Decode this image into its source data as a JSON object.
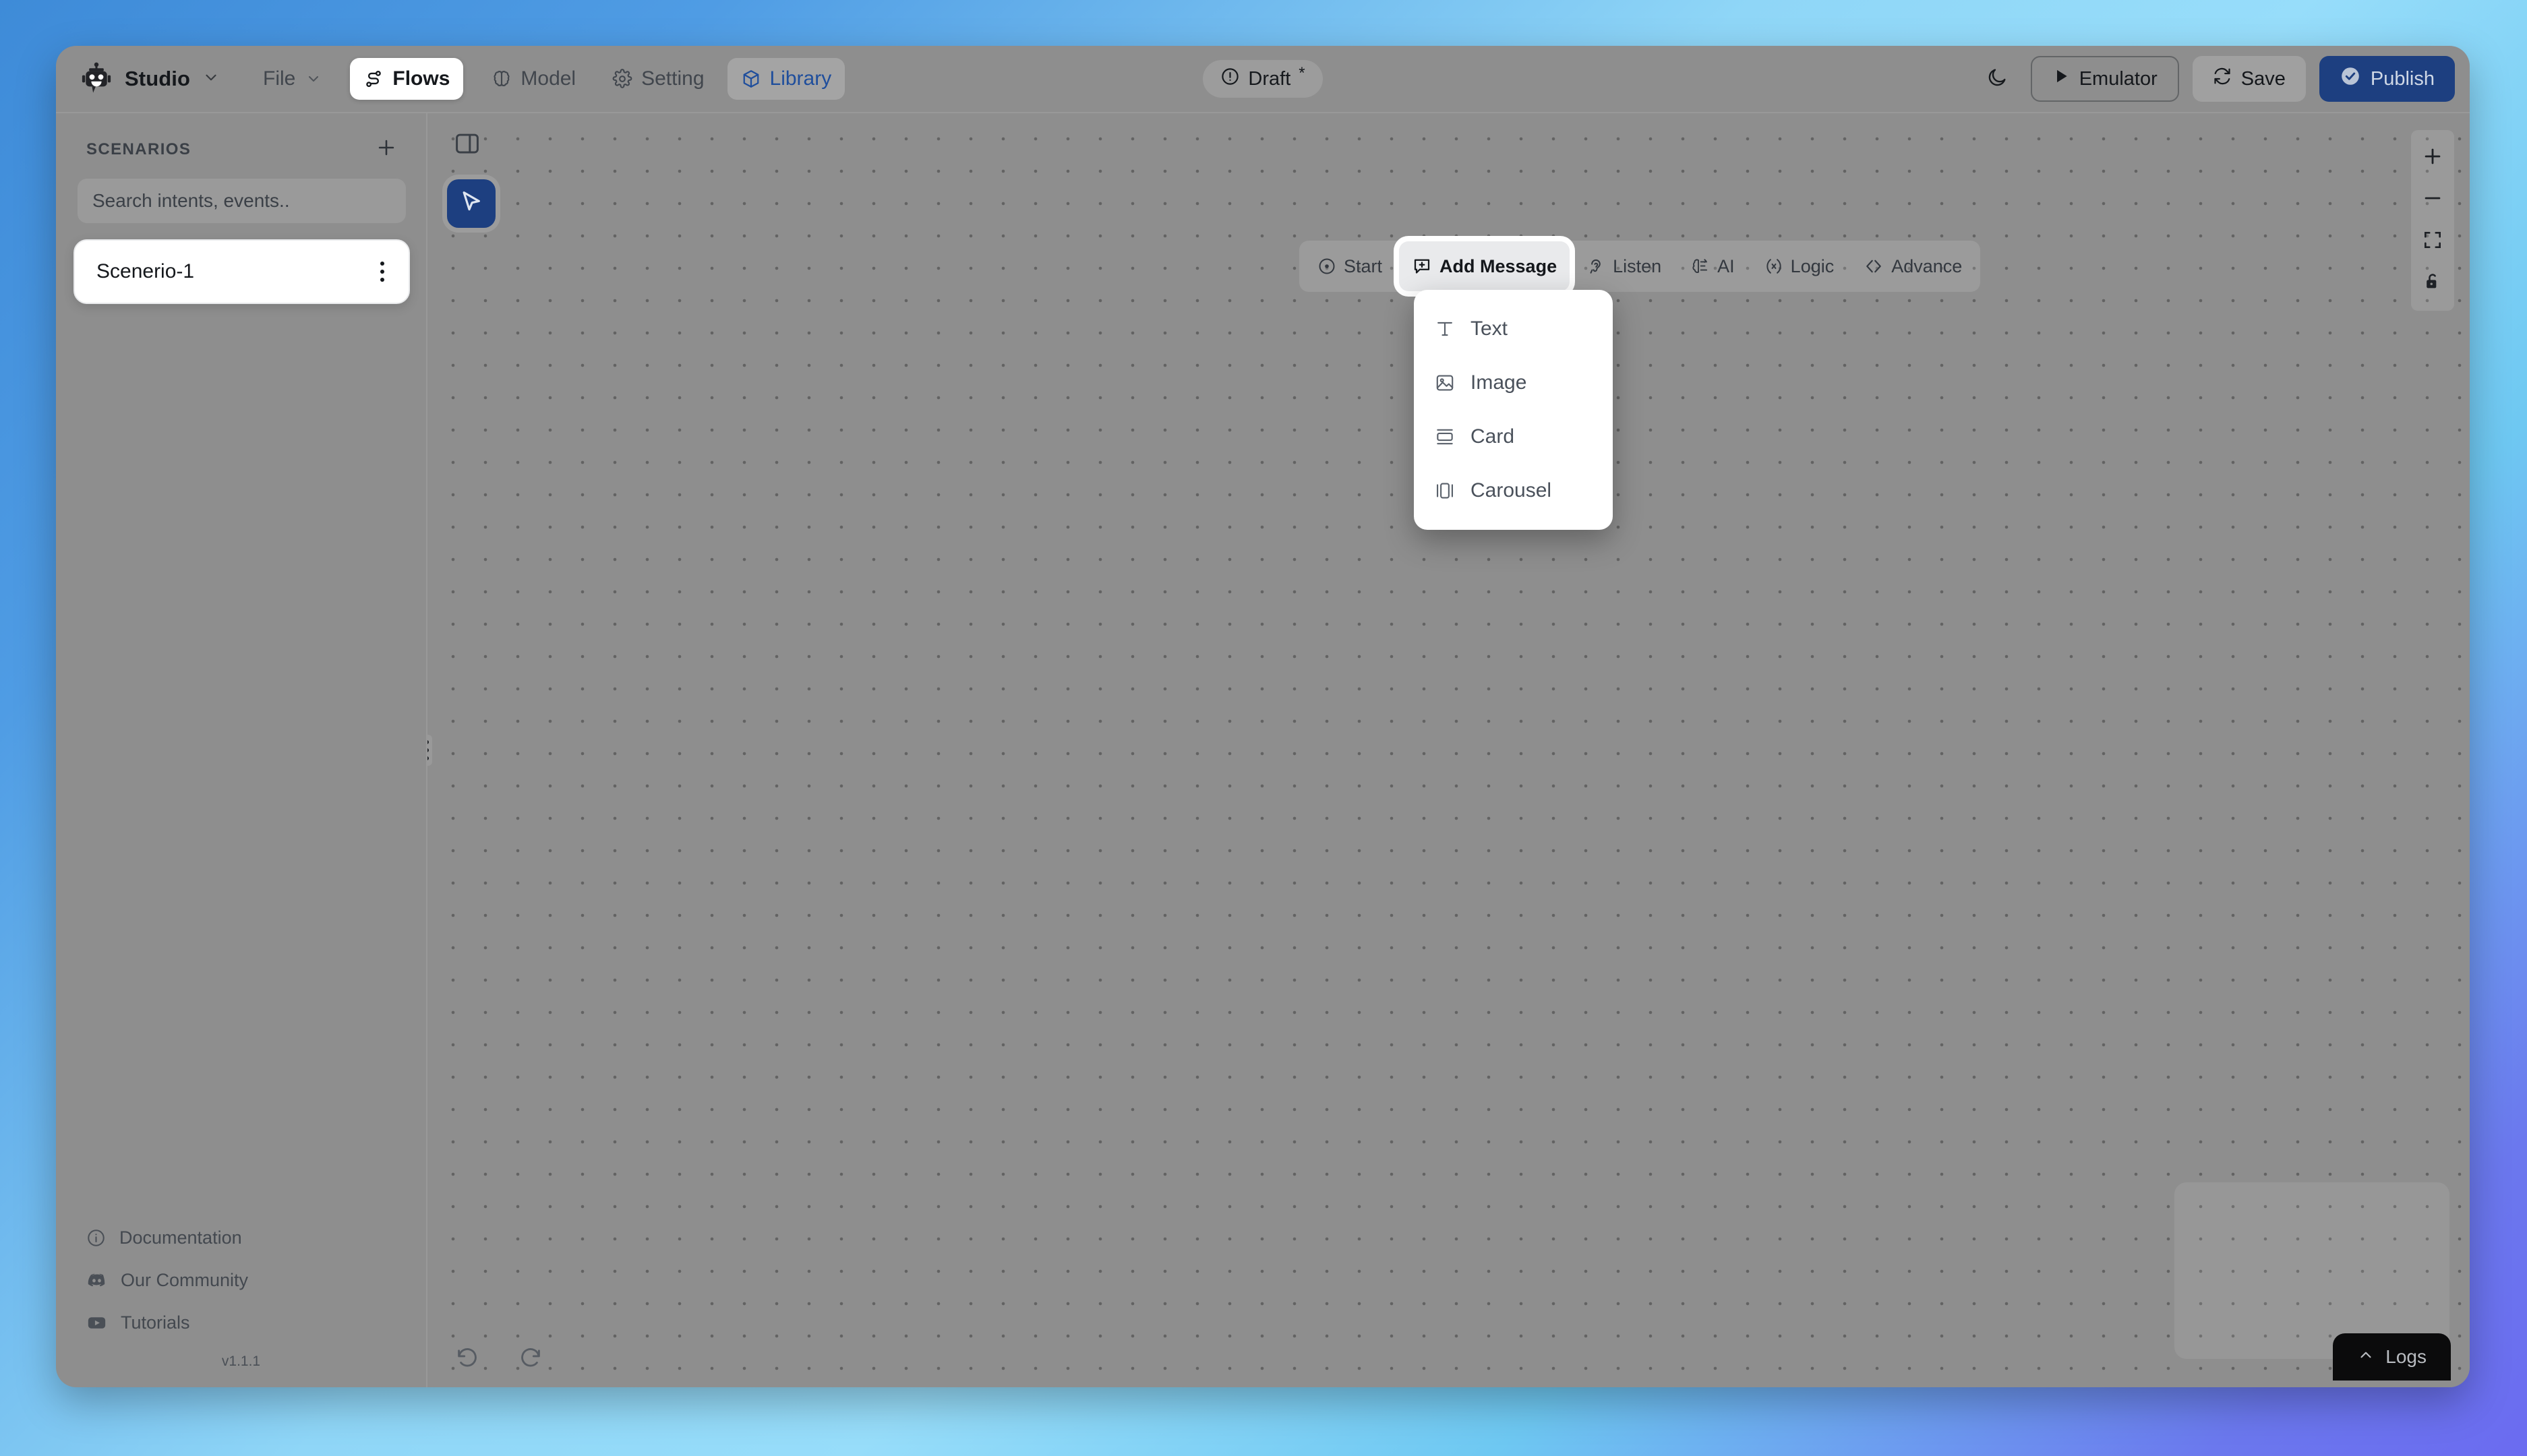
{
  "app": {
    "brand_name": "Studio",
    "brand_icon": "robot-icon",
    "version": "v1.1.1"
  },
  "topbar": {
    "menus": [
      {
        "label": "File",
        "icon": "chevron-down-icon",
        "state": "default"
      },
      {
        "label": "Flows",
        "icon": "flow-icon",
        "state": "active-white"
      },
      {
        "label": "Model",
        "icon": "brain-icon",
        "state": "default"
      },
      {
        "label": "Setting",
        "icon": "gear-icon",
        "state": "default"
      },
      {
        "label": "Library",
        "icon": "cube-icon",
        "state": "active-blue"
      }
    ],
    "status": {
      "label": "Draft",
      "marker": "*",
      "icon": "alert-circle-icon"
    },
    "actions": {
      "theme_toggle_icon": "moon-icon",
      "emulator_label": "Emulator",
      "emulator_icon": "play-icon",
      "save_label": "Save",
      "save_icon": "sync-icon",
      "publish_label": "Publish",
      "publish_icon": "check-circle-icon"
    },
    "colors": {
      "publish_bg": "#1d3f80",
      "library_accent": "#1f4e9c"
    }
  },
  "sidebar": {
    "title": "SCENARIOS",
    "add_icon": "plus-icon",
    "search": {
      "placeholder": "Search intents, events..",
      "value": ""
    },
    "scenarios": [
      {
        "name": "Scenerio-1",
        "menu_icon": "kebab-menu-icon",
        "selected": true
      }
    ],
    "footer_links": [
      {
        "label": "Documentation",
        "icon": "info-circle-icon"
      },
      {
        "label": "Our Community",
        "icon": "discord-icon"
      },
      {
        "label": "Tutorials",
        "icon": "youtube-icon"
      }
    ]
  },
  "canvas": {
    "panel_toggle_icon": "sidebar-panel-icon",
    "cursor_tool_icon": "cursor-arrow-icon",
    "cursor_tool_color": "#1d3f80",
    "grip_icon": "drag-handle-icon",
    "toolbar": [
      {
        "label": "Start",
        "icon": "start-circle-icon",
        "open": false
      },
      {
        "label": "Add Message",
        "icon": "message-plus-icon",
        "open": true
      },
      {
        "label": "Listen",
        "icon": "ear-icon",
        "open": false
      },
      {
        "label": "AI",
        "icon": "ai-node-icon",
        "open": false
      },
      {
        "label": "Logic",
        "icon": "logic-x-icon",
        "open": false
      },
      {
        "label": "Advance",
        "icon": "code-brackets-icon",
        "open": false
      }
    ],
    "add_message_menu": [
      {
        "label": "Text",
        "icon": "text-t-icon"
      },
      {
        "label": "Image",
        "icon": "image-icon"
      },
      {
        "label": "Card",
        "icon": "card-icon"
      },
      {
        "label": "Carousel",
        "icon": "carousel-icon"
      }
    ],
    "controls": [
      {
        "name": "zoom-in",
        "icon": "plus-icon"
      },
      {
        "name": "zoom-out",
        "icon": "minus-icon"
      },
      {
        "name": "fit-view",
        "icon": "fit-screen-icon"
      },
      {
        "name": "lock-canvas",
        "icon": "lock-open-icon"
      }
    ],
    "history": [
      {
        "name": "undo",
        "icon": "undo-arrow-icon"
      },
      {
        "name": "redo",
        "icon": "redo-arrow-icon"
      }
    ],
    "logs": {
      "label": "Logs",
      "icon": "chevron-up-icon"
    }
  }
}
